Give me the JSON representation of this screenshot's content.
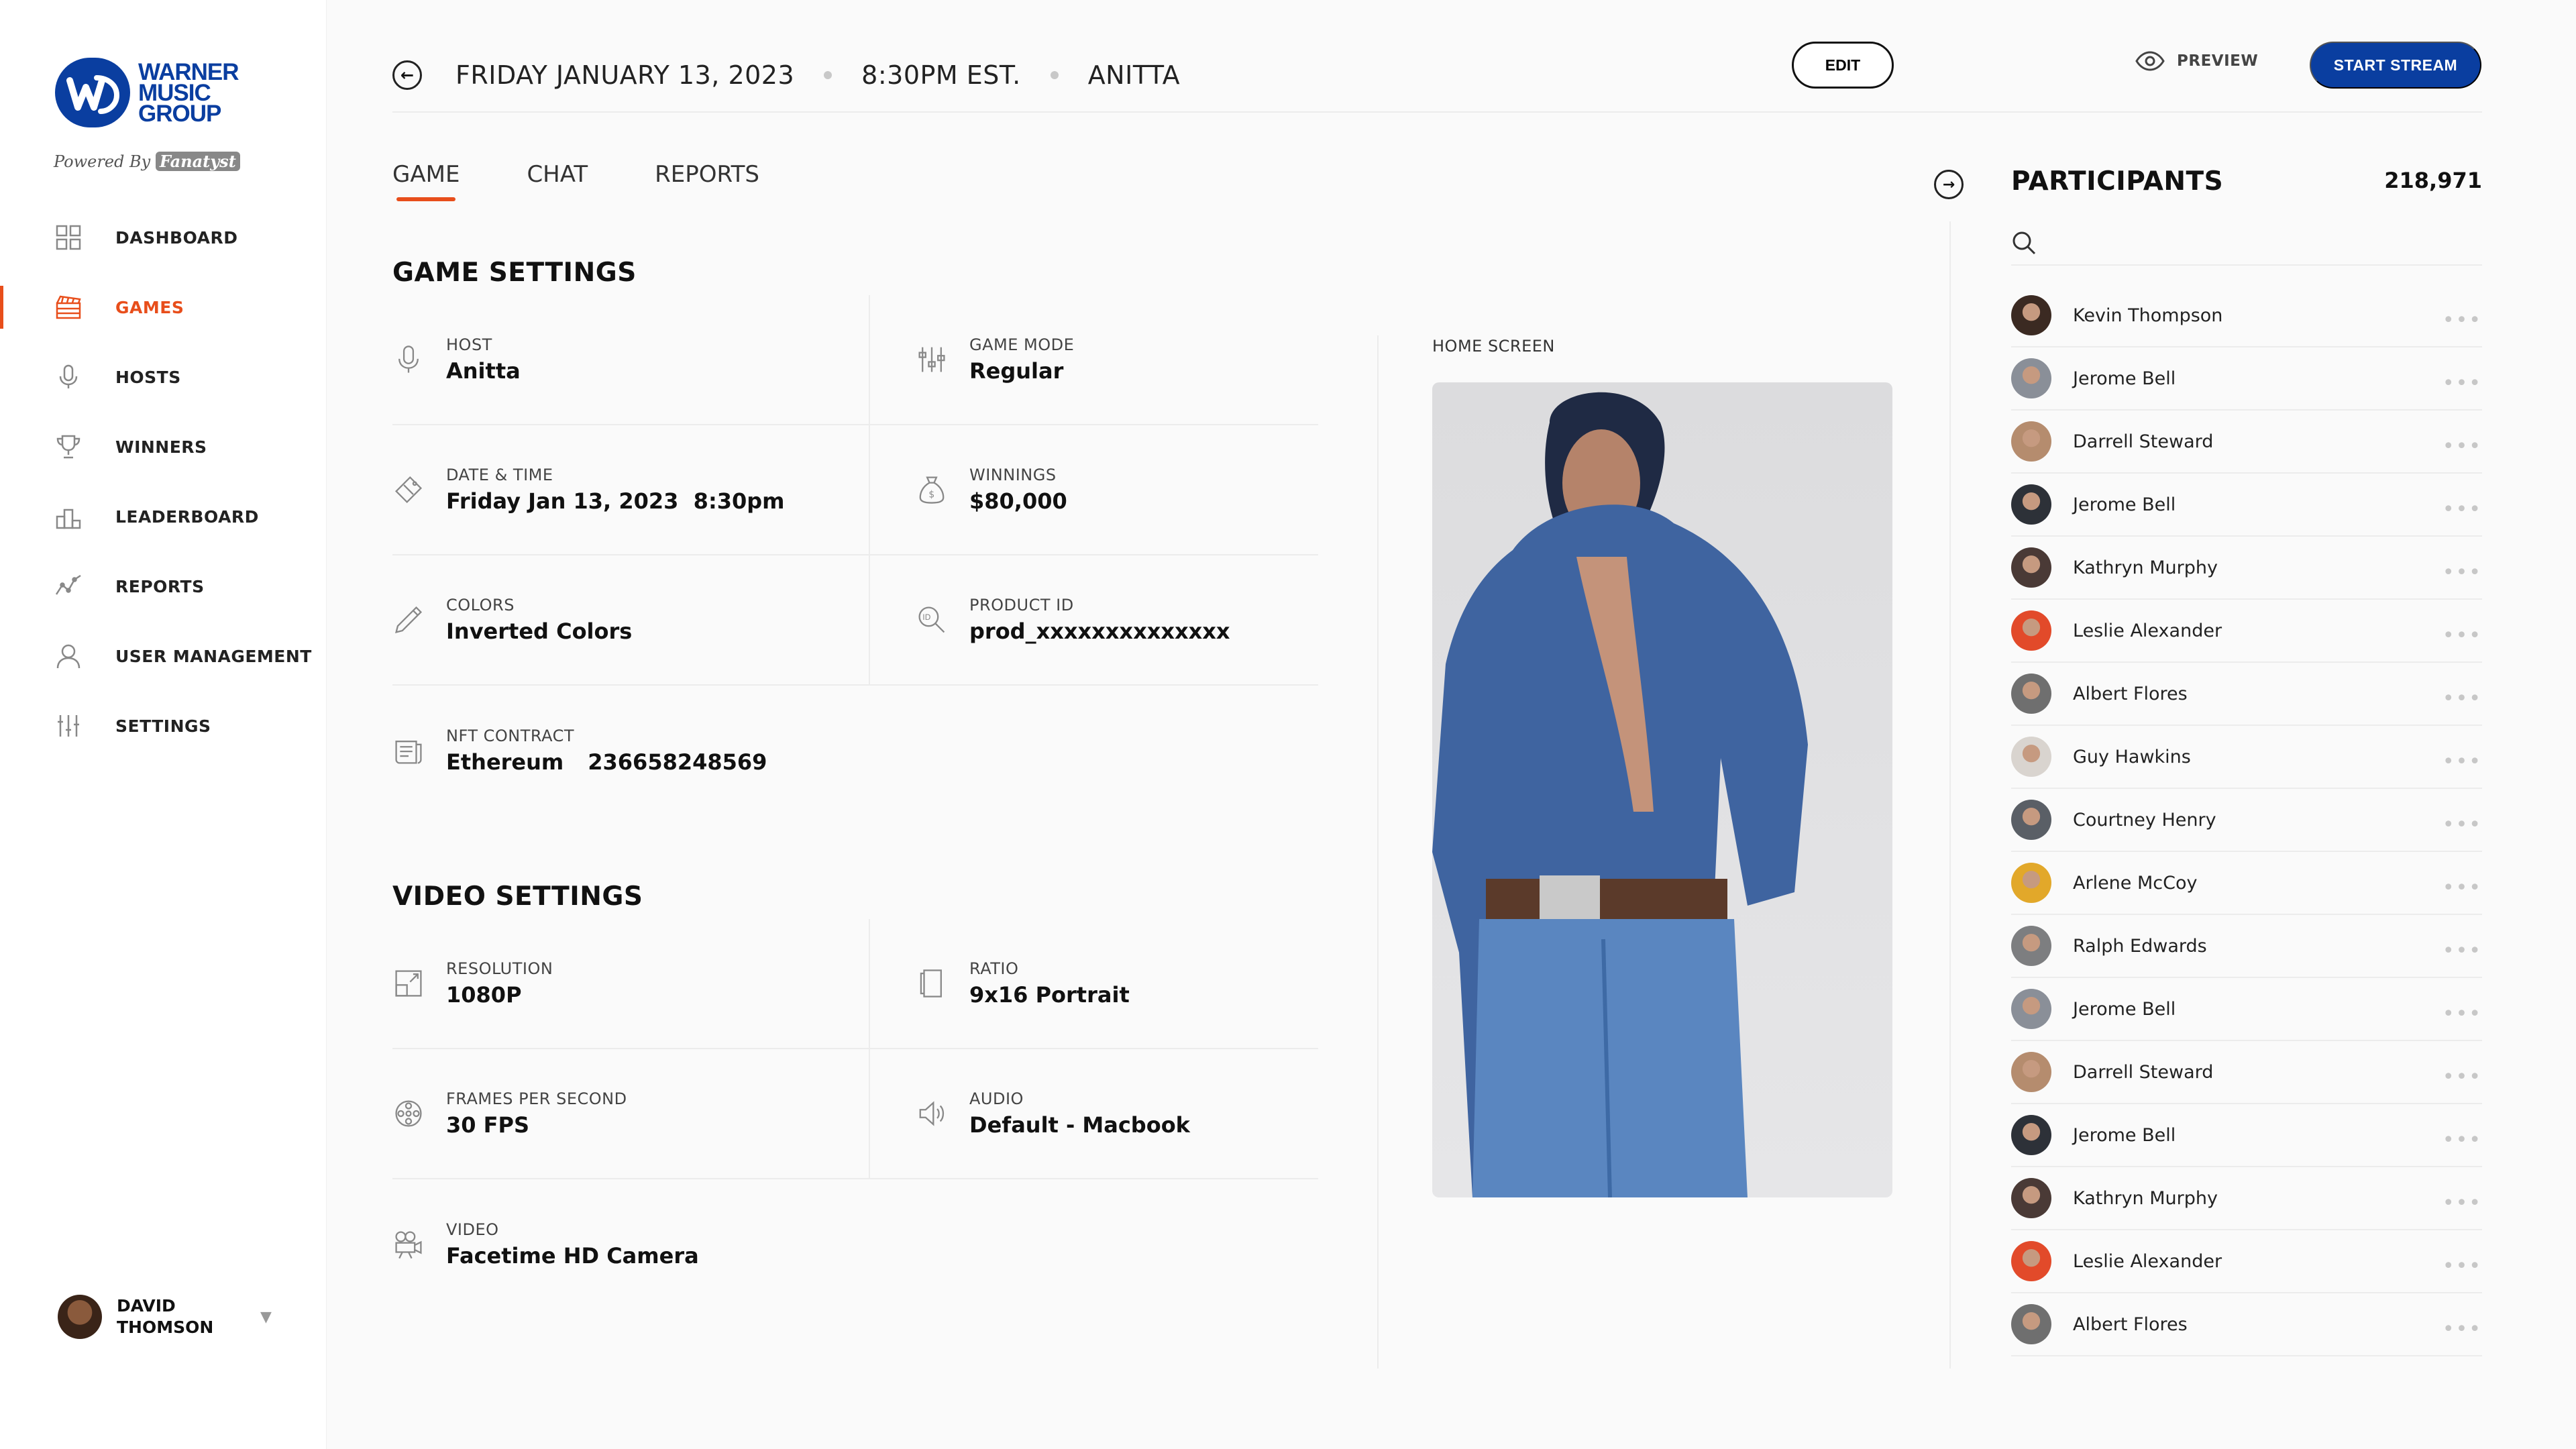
{
  "brand": {
    "logo_lines": [
      "WARNER",
      "MUSIC",
      "GROUP"
    ],
    "powered_by": "Powered By",
    "powered_brand": "Fanatyst"
  },
  "nav": [
    {
      "label": "DASHBOARD",
      "icon": "dashboard-icon",
      "active": false
    },
    {
      "label": "GAMES",
      "icon": "clapperboard-icon",
      "active": true
    },
    {
      "label": "HOSTS",
      "icon": "microphone-icon",
      "active": false
    },
    {
      "label": "WINNERS",
      "icon": "trophy-icon",
      "active": false
    },
    {
      "label": "LEADERBOARD",
      "icon": "podium-icon",
      "active": false
    },
    {
      "label": "REPORTS",
      "icon": "trend-icon",
      "active": false
    },
    {
      "label": "USER MANAGEMENT",
      "icon": "user-icon",
      "active": false
    },
    {
      "label": "SETTINGS",
      "icon": "sliders-icon",
      "active": false
    }
  ],
  "user": {
    "name": "DAVID THOMSON"
  },
  "header": {
    "date": "FRIDAY JANUARY 13, 2023",
    "time": "8:30PM EST.",
    "artist": "ANITTA",
    "edit_label": "EDIT",
    "preview_label": "PREVIEW",
    "start_label": "START STREAM"
  },
  "tabs": [
    {
      "label": "GAME",
      "active": true
    },
    {
      "label": "CHAT",
      "active": false
    },
    {
      "label": "REPORTS",
      "active": false
    }
  ],
  "game_settings": {
    "title": "GAME SETTINGS",
    "host": {
      "label": "HOST",
      "value": "Anitta"
    },
    "game_mode": {
      "label": "GAME MODE",
      "value": "Regular"
    },
    "date_time": {
      "label": "DATE & TIME",
      "value": "Friday Jan 13, 2023",
      "time": "8:30pm"
    },
    "winnings": {
      "label": "WINNINGS",
      "value": "$80,000"
    },
    "colors": {
      "label": "COLORS",
      "value": "Inverted Colors"
    },
    "product_id": {
      "label": "PRODUCT ID",
      "value": "prod_xxxxxxxxxxxxxx"
    },
    "nft_contract": {
      "label": "NFT CONTRACT",
      "value": "Ethereum",
      "number": "236658248569"
    }
  },
  "video_settings": {
    "title": "VIDEO SETTINGS",
    "resolution": {
      "label": "RESOLUTION",
      "value": "1080P"
    },
    "ratio": {
      "label": "RATIO",
      "value": "9x16 Portrait"
    },
    "fps": {
      "label": "FRAMES PER SECOND",
      "value": "30 FPS"
    },
    "audio": {
      "label": "AUDIO",
      "value": "Default - Macbook"
    },
    "video": {
      "label": "VIDEO",
      "value": "Facetime HD Camera"
    }
  },
  "home_screen": {
    "label": "HOME SCREEN"
  },
  "participants": {
    "title": "PARTICIPANTS",
    "count": "218,971",
    "search_placeholder": "",
    "list": [
      {
        "name": "Kevin Thompson",
        "color": "#3b2a22"
      },
      {
        "name": "Jerome Bell",
        "color": "#8a8f98"
      },
      {
        "name": "Darrell Steward",
        "color": "#b58c6e"
      },
      {
        "name": "Jerome Bell",
        "color": "#2d3138"
      },
      {
        "name": "Kathryn Murphy",
        "color": "#4a3a36"
      },
      {
        "name": "Leslie Alexander",
        "color": "#e24a2a"
      },
      {
        "name": "Albert Flores",
        "color": "#6f6f6f"
      },
      {
        "name": "Guy Hawkins",
        "color": "#d9d4cf"
      },
      {
        "name": "Courtney Henry",
        "color": "#5a5f66"
      },
      {
        "name": "Arlene McCoy",
        "color": "#e2a82a"
      },
      {
        "name": "Ralph Edwards",
        "color": "#7d7e80"
      },
      {
        "name": "Jerome Bell",
        "color": "#8a8f98"
      },
      {
        "name": "Darrell Steward",
        "color": "#b58c6e"
      },
      {
        "name": "Jerome Bell",
        "color": "#2d3138"
      },
      {
        "name": "Kathryn Murphy",
        "color": "#4a3a36"
      },
      {
        "name": "Leslie Alexander",
        "color": "#e24a2a"
      },
      {
        "name": "Albert Flores",
        "color": "#6f6f6f"
      }
    ]
  },
  "colors": {
    "accent": "#e84e1b",
    "brand": "#0a3ea0"
  }
}
